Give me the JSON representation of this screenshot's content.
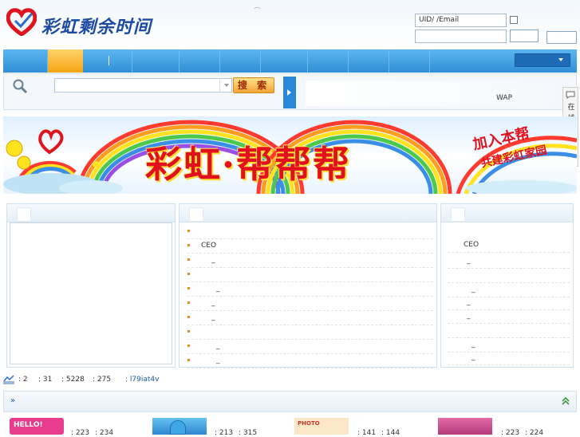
{
  "header": {
    "logo_text": "彩虹剩余时间",
    "login": {
      "uid_placeholder": "UID/  /Email"
    }
  },
  "nav": {
    "items": [
      "",
      "",
      "",
      "",
      "",
      "",
      "",
      "",
      "",
      "",
      ""
    ]
  },
  "search": {
    "button_label": "搜 索",
    "wap_label": "WAP"
  },
  "online_service": {
    "label": "在线客服"
  },
  "banner": {
    "title": "彩虹·帮帮帮",
    "side_line1": "加入本帮",
    "side_line2": "共建彩虹家园"
  },
  "middle_panel": {
    "rows": [
      "",
      "CEO",
      "_",
      "",
      "_",
      "_",
      "_",
      "",
      "_",
      "_"
    ]
  },
  "right_panel": {
    "rows": [
      "CEO",
      "_",
      "",
      "_",
      "_",
      "_",
      "",
      "_",
      "_"
    ]
  },
  "stats": {
    "items": [
      ": 2",
      ": 31",
      ": 5228",
      ": 275"
    ],
    "newest_member": ": l79iat4v"
  },
  "bottom": {
    "raquo": "»",
    "thumb_stats": [
      {
        "a": ": 223",
        "b": ": 234"
      },
      {
        "a": ": 213",
        "b": ": 315"
      },
      {
        "a": ": 141",
        "b": ": 144"
      },
      {
        "a": ": 223",
        "b": ": 224"
      }
    ],
    "thumb_labels": [
      "HELLO!",
      "",
      "PHOTO",
      ""
    ]
  },
  "colors": {
    "nav_blue": "#3a9ae0",
    "nav_active": "#f6a312",
    "search_button": "#f3a537",
    "banner_red": "#e0101e",
    "bullet_orange": "#f08a1e"
  }
}
